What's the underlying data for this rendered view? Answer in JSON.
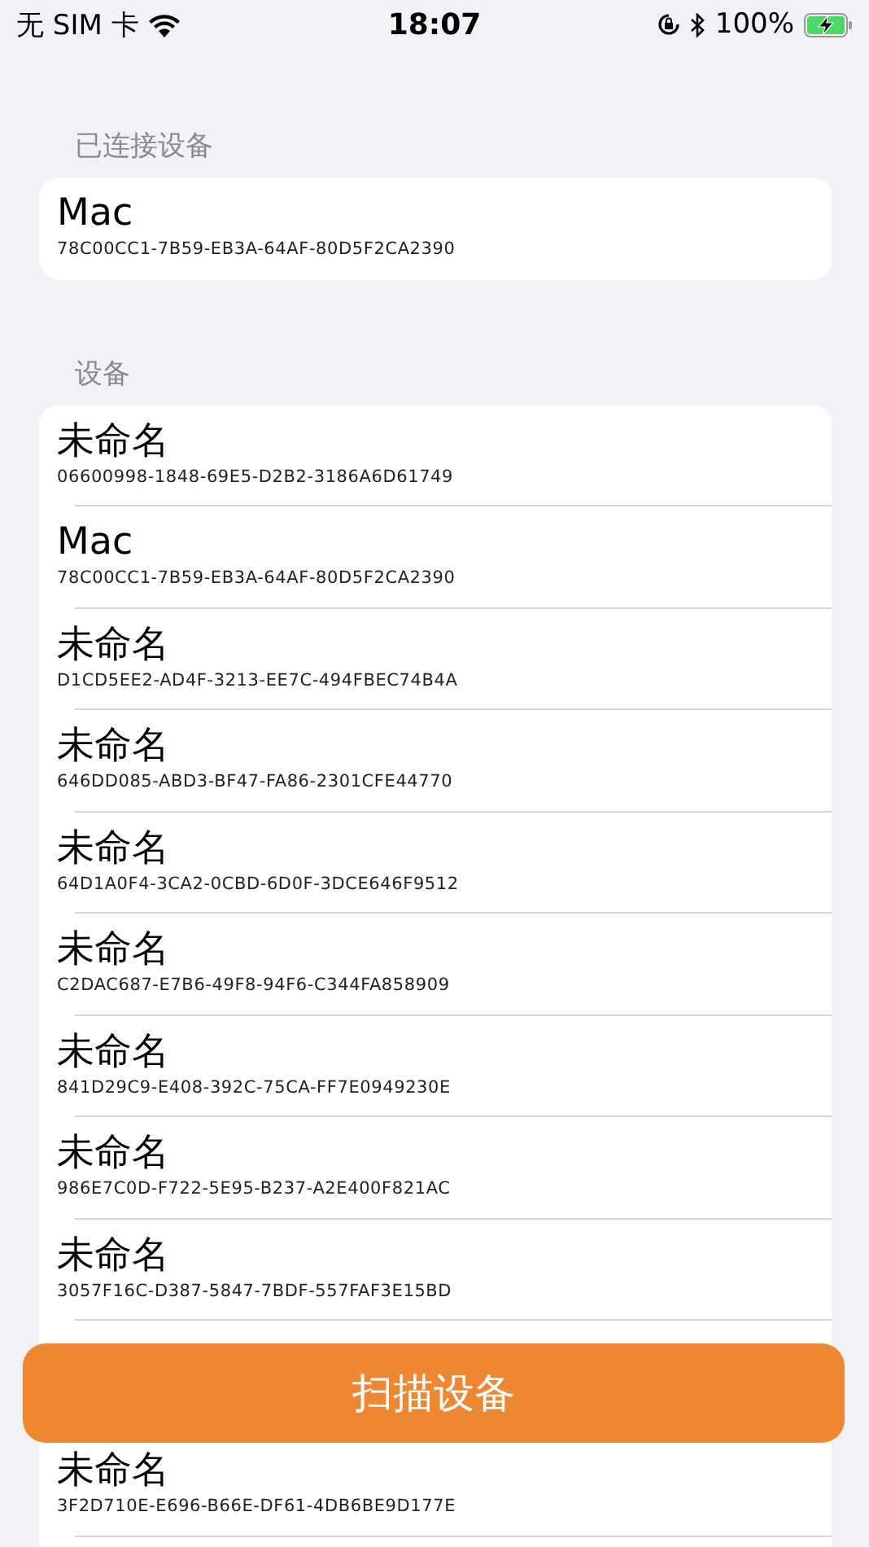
{
  "status_bar": {
    "carrier": "无 SIM 卡",
    "time": "18:07",
    "battery": "100%"
  },
  "connected_section": {
    "header": "已连接设备",
    "devices": [
      {
        "name": "Mac",
        "uuid": "78C00CC1-7B59-EB3A-64AF-80D5F2CA2390"
      }
    ]
  },
  "devices_section": {
    "header": "设备",
    "devices": [
      {
        "name": "未命名",
        "uuid": "06600998-1848-69E5-D2B2-3186A6D61749"
      },
      {
        "name": "Mac",
        "uuid": "78C00CC1-7B59-EB3A-64AF-80D5F2CA2390"
      },
      {
        "name": "未命名",
        "uuid": "D1CD5EE2-AD4F-3213-EE7C-494FBEC74B4A"
      },
      {
        "name": "未命名",
        "uuid": "646DD085-ABD3-BF47-FA86-2301CFE44770"
      },
      {
        "name": "未命名",
        "uuid": "64D1A0F4-3CA2-0CBD-6D0F-3DCE646F9512"
      },
      {
        "name": "未命名",
        "uuid": "C2DAC687-E7B6-49F8-94F6-C344FA858909"
      },
      {
        "name": "未命名",
        "uuid": "841D29C9-E408-392C-75CA-FF7E0949230E"
      },
      {
        "name": "未命名",
        "uuid": "986E7C0D-F722-5E95-B237-A2E400F821AC"
      },
      {
        "name": "未命名",
        "uuid": "3057F16C-D387-5847-7BDF-557FAF3E15BD"
      }
    ],
    "devices_below_button": [
      {
        "name": "未命名",
        "uuid": "3F2D710E-E696-B66E-DF61-4DB6BE9D177E"
      }
    ]
  },
  "scan_button": {
    "label": "扫描设备"
  }
}
